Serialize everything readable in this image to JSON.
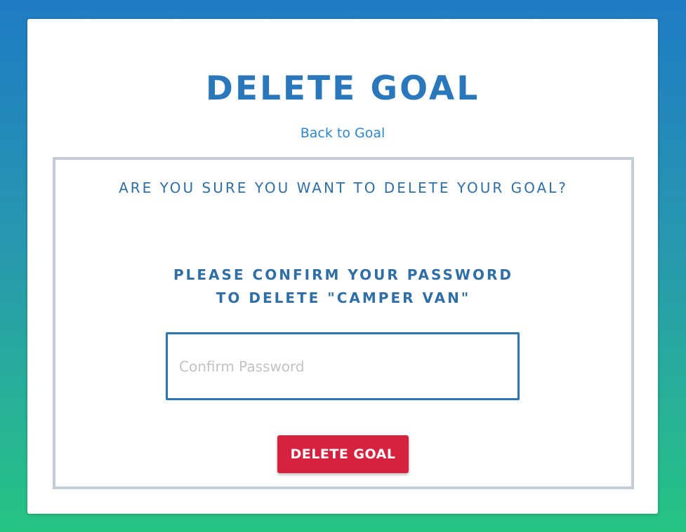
{
  "page": {
    "title": "DELETE GOAL",
    "back_link": "Back to Goal"
  },
  "confirm": {
    "question": "ARE YOU SURE YOU WANT TO DELETE YOUR GOAL?",
    "instruction_line1": "PLEASE CONFIRM YOUR PASSWORD",
    "instruction_line2": "TO DELETE \"CAMPER VAN\"",
    "password": {
      "value": "",
      "placeholder": "Confirm Password"
    },
    "delete_button_label": "DELETE GOAL"
  },
  "colors": {
    "gradient_top": "#1f7bc4",
    "gradient_bottom": "#27c484",
    "heading_blue": "#2a78bb",
    "link_blue": "#2e86cc",
    "box_border": "#c4ccd6",
    "danger_red": "#d6223f"
  }
}
